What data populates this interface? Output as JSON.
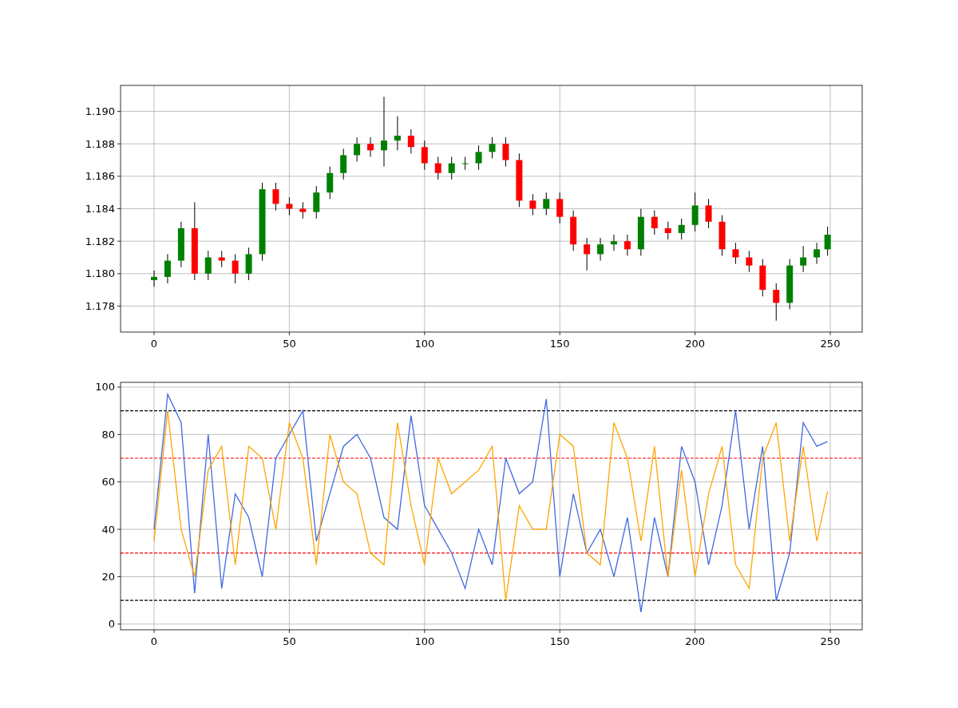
{
  "price_chart": {
    "chart_data": {
      "type": "candlestick",
      "grid": true,
      "x": [
        0,
        5,
        10,
        15,
        20,
        25,
        30,
        35,
        40,
        45,
        50,
        55,
        60,
        65,
        70,
        75,
        80,
        85,
        90,
        95,
        100,
        105,
        110,
        115,
        120,
        125,
        130,
        135,
        140,
        145,
        150,
        155,
        160,
        165,
        170,
        175,
        180,
        185,
        190,
        195,
        200,
        205,
        210,
        215,
        220,
        225,
        230,
        235,
        240,
        245,
        249
      ],
      "ohlc": [
        [
          1.1796,
          1.1802,
          1.1792,
          1.1798
        ],
        [
          1.1798,
          1.1812,
          1.1794,
          1.1808
        ],
        [
          1.1808,
          1.1832,
          1.1804,
          1.1828
        ],
        [
          1.1828,
          1.1844,
          1.1796,
          1.18
        ],
        [
          1.18,
          1.1814,
          1.1796,
          1.181
        ],
        [
          1.181,
          1.1814,
          1.1804,
          1.1808
        ],
        [
          1.1808,
          1.1812,
          1.1794,
          1.18
        ],
        [
          1.18,
          1.1816,
          1.1796,
          1.1812
        ],
        [
          1.1812,
          1.1856,
          1.1808,
          1.1852
        ],
        [
          1.1852,
          1.1856,
          1.1839,
          1.1843
        ],
        [
          1.1843,
          1.1847,
          1.1836,
          1.184
        ],
        [
          1.184,
          1.1844,
          1.1834,
          1.1838
        ],
        [
          1.1838,
          1.1854,
          1.1834,
          1.185
        ],
        [
          1.185,
          1.1866,
          1.1846,
          1.1862
        ],
        [
          1.1862,
          1.1877,
          1.1858,
          1.1873
        ],
        [
          1.1873,
          1.1884,
          1.1869,
          1.188
        ],
        [
          1.188,
          1.1884,
          1.1872,
          1.1876
        ],
        [
          1.1876,
          1.1909,
          1.1866,
          1.1882
        ],
        [
          1.1882,
          1.1897,
          1.1876,
          1.1885
        ],
        [
          1.1885,
          1.1889,
          1.1874,
          1.1878
        ],
        [
          1.1878,
          1.1882,
          1.1864,
          1.1868
        ],
        [
          1.1868,
          1.1872,
          1.1858,
          1.1862
        ],
        [
          1.1862,
          1.1872,
          1.1858,
          1.1868
        ],
        [
          1.1868,
          1.1872,
          1.1864,
          1.1868
        ],
        [
          1.1868,
          1.1879,
          1.1864,
          1.1875
        ],
        [
          1.1875,
          1.1884,
          1.1871,
          1.188
        ],
        [
          1.188,
          1.1884,
          1.1866,
          1.187
        ],
        [
          1.187,
          1.1874,
          1.1841,
          1.1845
        ],
        [
          1.1845,
          1.1849,
          1.1836,
          1.184
        ],
        [
          1.184,
          1.185,
          1.1836,
          1.1846
        ],
        [
          1.1846,
          1.185,
          1.1831,
          1.1835
        ],
        [
          1.1835,
          1.1839,
          1.1814,
          1.1818
        ],
        [
          1.1818,
          1.1822,
          1.1802,
          1.1812
        ],
        [
          1.1812,
          1.1822,
          1.1808,
          1.1818
        ],
        [
          1.1818,
          1.1824,
          1.1814,
          1.182
        ],
        [
          1.182,
          1.1824,
          1.1811,
          1.1815
        ],
        [
          1.1815,
          1.184,
          1.1811,
          1.1835
        ],
        [
          1.1835,
          1.1839,
          1.1824,
          1.1828
        ],
        [
          1.1828,
          1.1832,
          1.1821,
          1.1825
        ],
        [
          1.1825,
          1.1834,
          1.1821,
          1.183
        ],
        [
          1.183,
          1.185,
          1.1826,
          1.1842
        ],
        [
          1.1842,
          1.1846,
          1.1828,
          1.1832
        ],
        [
          1.1832,
          1.1836,
          1.1811,
          1.1815
        ],
        [
          1.1815,
          1.1819,
          1.1806,
          1.181
        ],
        [
          1.181,
          1.1814,
          1.1801,
          1.1805
        ],
        [
          1.1805,
          1.1809,
          1.1786,
          1.179
        ],
        [
          1.179,
          1.1794,
          1.1771,
          1.1782
        ],
        [
          1.1782,
          1.1809,
          1.1778,
          1.1805
        ],
        [
          1.1805,
          1.1817,
          1.1801,
          1.181
        ],
        [
          1.181,
          1.1819,
          1.1806,
          1.1815
        ],
        [
          1.1815,
          1.1829,
          1.1811,
          1.1824
        ]
      ],
      "xlim": [
        -12.4,
        261.8
      ],
      "ylim": [
        1.1764,
        1.1916
      ],
      "xticks": [
        0,
        50,
        100,
        150,
        200,
        250
      ],
      "yticks": [
        {
          "value": 1.178,
          "label": "1.178"
        },
        {
          "value": 1.18,
          "label": "1.180"
        },
        {
          "value": 1.182,
          "label": "1.182"
        },
        {
          "value": 1.184,
          "label": "1.184"
        },
        {
          "value": 1.186,
          "label": "1.186"
        },
        {
          "value": 1.188,
          "label": "1.188"
        },
        {
          "value": 1.19,
          "label": "1.190"
        }
      ]
    }
  },
  "oscillator_chart": {
    "chart_data": {
      "type": "line",
      "grid": true,
      "x": [
        0,
        5,
        10,
        15,
        20,
        25,
        30,
        35,
        40,
        45,
        50,
        55,
        60,
        65,
        70,
        75,
        80,
        85,
        90,
        95,
        100,
        105,
        110,
        115,
        120,
        125,
        130,
        135,
        140,
        145,
        150,
        155,
        160,
        165,
        170,
        175,
        180,
        185,
        190,
        195,
        200,
        205,
        210,
        215,
        220,
        225,
        230,
        235,
        240,
        245,
        249
      ],
      "series": [
        {
          "color": "#4169e1",
          "values": [
            40,
            97,
            85,
            13,
            80,
            15,
            55,
            45,
            20,
            70,
            80,
            90,
            35,
            55,
            75,
            80,
            70,
            45,
            40,
            88,
            50,
            40,
            30,
            15,
            40,
            25,
            70,
            55,
            60,
            95,
            20,
            55,
            30,
            40,
            20,
            45,
            5,
            45,
            20,
            75,
            60,
            25,
            50,
            90,
            40,
            75,
            10,
            30,
            85,
            75,
            77
          ]
        },
        {
          "color": "#ffa500",
          "values": [
            35,
            90,
            40,
            20,
            65,
            75,
            25,
            75,
            70,
            40,
            85,
            70,
            25,
            80,
            60,
            55,
            30,
            25,
            85,
            50,
            25,
            70,
            55,
            60,
            65,
            75,
            10,
            50,
            40,
            40,
            80,
            75,
            30,
            25,
            85,
            70,
            35,
            75,
            20,
            65,
            20,
            55,
            75,
            25,
            15,
            70,
            85,
            35,
            75,
            35,
            56
          ]
        }
      ],
      "xlim": [
        -12.4,
        261.8
      ],
      "ylim": [
        -2.4,
        102
      ],
      "xticks": [
        0,
        50,
        100,
        150,
        200,
        250
      ],
      "yticks": [
        0,
        20,
        40,
        60,
        80,
        100
      ],
      "ref_lines": [
        {
          "axis": "y",
          "value": 90,
          "color": "#000000"
        },
        {
          "axis": "y",
          "value": 70,
          "color": "#ff0000"
        },
        {
          "axis": "y",
          "value": 30,
          "color": "#ff0000"
        },
        {
          "axis": "y",
          "value": 10,
          "color": "#000000"
        }
      ]
    }
  }
}
